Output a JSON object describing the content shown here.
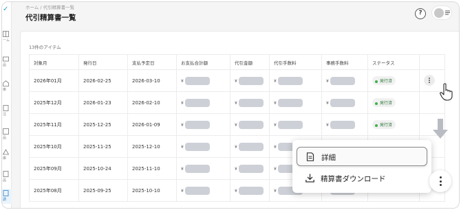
{
  "breadcrumb": {
    "home": "ホーム",
    "sep": "/",
    "current": "代引精算書一覧"
  },
  "page_title": "代引精算書一覧",
  "header": {
    "help_icon": "question-circle-icon",
    "user_avatar": "avatar",
    "menu_icon": "menu-lines-icon"
  },
  "sidebar": {
    "items": [
      {
        "label": "ーム",
        "icon": "grid-icon"
      },
      {
        "label": "品",
        "icon": "box-icon"
      },
      {
        "label": "庫",
        "icon": "warehouse-icon"
      },
      {
        "label": "注",
        "icon": "order-icon"
      },
      {
        "label": "品",
        "icon": "item-icon"
      },
      {
        "label": "庫",
        "icon": "stock-icon"
      },
      {
        "label": "品",
        "icon": "doc-icon"
      },
      {
        "label": "請",
        "icon": "invoice-icon",
        "active": true
      }
    ]
  },
  "table": {
    "count_label": "13件のアイテム",
    "columns": [
      "対象月",
      "発行日",
      "支払予定日",
      "お支払合計額",
      "代引金額",
      "代引手数料",
      "事務手数料",
      "ステータス",
      ""
    ],
    "currency": "¥",
    "rows": [
      {
        "month": "2026年01月",
        "issued": "2026-02-25",
        "due": "2026-03-10",
        "status": "発行済"
      },
      {
        "month": "2025年12月",
        "issued": "2026-01-23",
        "due": "2026-02-10",
        "status": "発行済"
      },
      {
        "month": "2025年11月",
        "issued": "2025-12-25",
        "due": "2026-01-09",
        "status": "発行済"
      },
      {
        "month": "2025年10月",
        "issued": "2025-11-25",
        "due": "2025-12-10",
        "status": ""
      },
      {
        "month": "2025年09月",
        "issued": "2025-10-24",
        "due": "2025-11-10",
        "status": ""
      },
      {
        "month": "2025年08月",
        "issued": "2025-09-25",
        "due": "2025-10-10",
        "status": ""
      }
    ]
  },
  "menu": {
    "detail": "詳細",
    "download": "精算書ダウンロード"
  },
  "colors": {
    "accent": "#2a9fd6",
    "status_green": "#3cb14a"
  }
}
